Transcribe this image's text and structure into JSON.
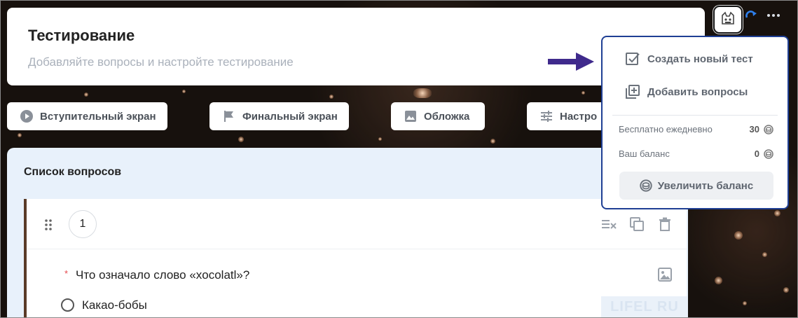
{
  "header": {
    "title": "Тестирование",
    "subtitle": "Добавляйте вопросы и настройте тестирование"
  },
  "tabs": [
    {
      "label": "Вступительный экран",
      "icon": "play-circle-icon"
    },
    {
      "label": "Финальный экран",
      "icon": "flag-icon"
    },
    {
      "label": "Обложка",
      "icon": "image-icon"
    },
    {
      "label": "Настро",
      "icon": "sliders-icon"
    }
  ],
  "questions": {
    "title": "Список вопросов",
    "items": [
      {
        "number": "1",
        "required_mark": "*",
        "text": "Что означало слово «xocolatl»?",
        "options": [
          "Какао-бобы"
        ]
      }
    ]
  },
  "dropdown": {
    "items": [
      {
        "label": "Создать новый тест",
        "icon": "checkbox-icon"
      },
      {
        "label": "Добавить вопросы",
        "icon": "add-box-icon"
      }
    ],
    "free_daily_label": "Бесплатно ежедневно",
    "free_daily_value": "30",
    "balance_label": "Ваш баланс",
    "balance_value": "0",
    "increase_label": "Увеличить баланс"
  },
  "watermark": "LIFEL RU",
  "colors": {
    "accent_border": "#1f3f94",
    "arrow": "#3f2a8c",
    "question_bar": "#5a3b28",
    "required": "#e5484d",
    "refresh": "#2f80ed"
  }
}
